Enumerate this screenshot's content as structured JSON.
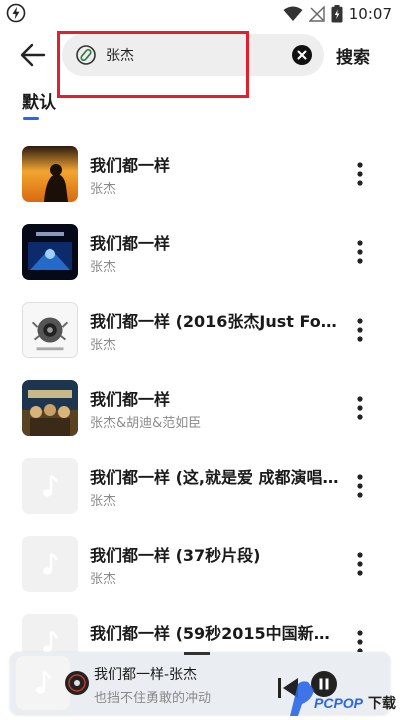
{
  "status_bar": {
    "time": "10:07",
    "icons": [
      "flash-icon",
      "wifi-icon",
      "no-signal-icon",
      "battery-icon"
    ]
  },
  "header": {
    "back_icon": "arrow-left-icon",
    "search": {
      "value": "张杰",
      "placeholder": "",
      "leading_icon": "link-icon",
      "clear_icon": "close-circle-icon"
    },
    "search_button_label": "搜索"
  },
  "tabs": [
    {
      "label": "默认",
      "active": true
    }
  ],
  "songs": [
    {
      "title": "我们都一样",
      "artist": "张杰",
      "cover": "album-sunset"
    },
    {
      "title": "我们都一样",
      "artist": "张杰",
      "cover": "album-concert"
    },
    {
      "title": "我们都一样 (2016张杰Just For S...",
      "artist": "张杰",
      "cover": "album-speaker"
    },
    {
      "title": "我们都一样",
      "artist": "张杰&胡迪&范如臣",
      "cover": "album-group"
    },
    {
      "title": "我们都一样 (这,就是爱 成都演唱...",
      "artist": "张杰",
      "cover": "music-note-placeholder"
    },
    {
      "title": "我们都一样 (37秒片段)",
      "artist": "张杰",
      "cover": "music-note-placeholder"
    },
    {
      "title": "我们都一样 (59秒2015中国新声...",
      "artist": "",
      "cover": "music-note-placeholder"
    }
  ],
  "player": {
    "title": "我们都一样-张杰",
    "subtitle": "也挡不住勇敢的冲动",
    "controls": [
      "previous-icon",
      "pause-icon"
    ]
  },
  "watermark": {
    "text": "PCPOP下载"
  },
  "colors": {
    "accent": "#2a66e6",
    "highlight_border": "#e0202a",
    "search_bg": "#eeeeee",
    "player_bg": "#eaedf2"
  }
}
